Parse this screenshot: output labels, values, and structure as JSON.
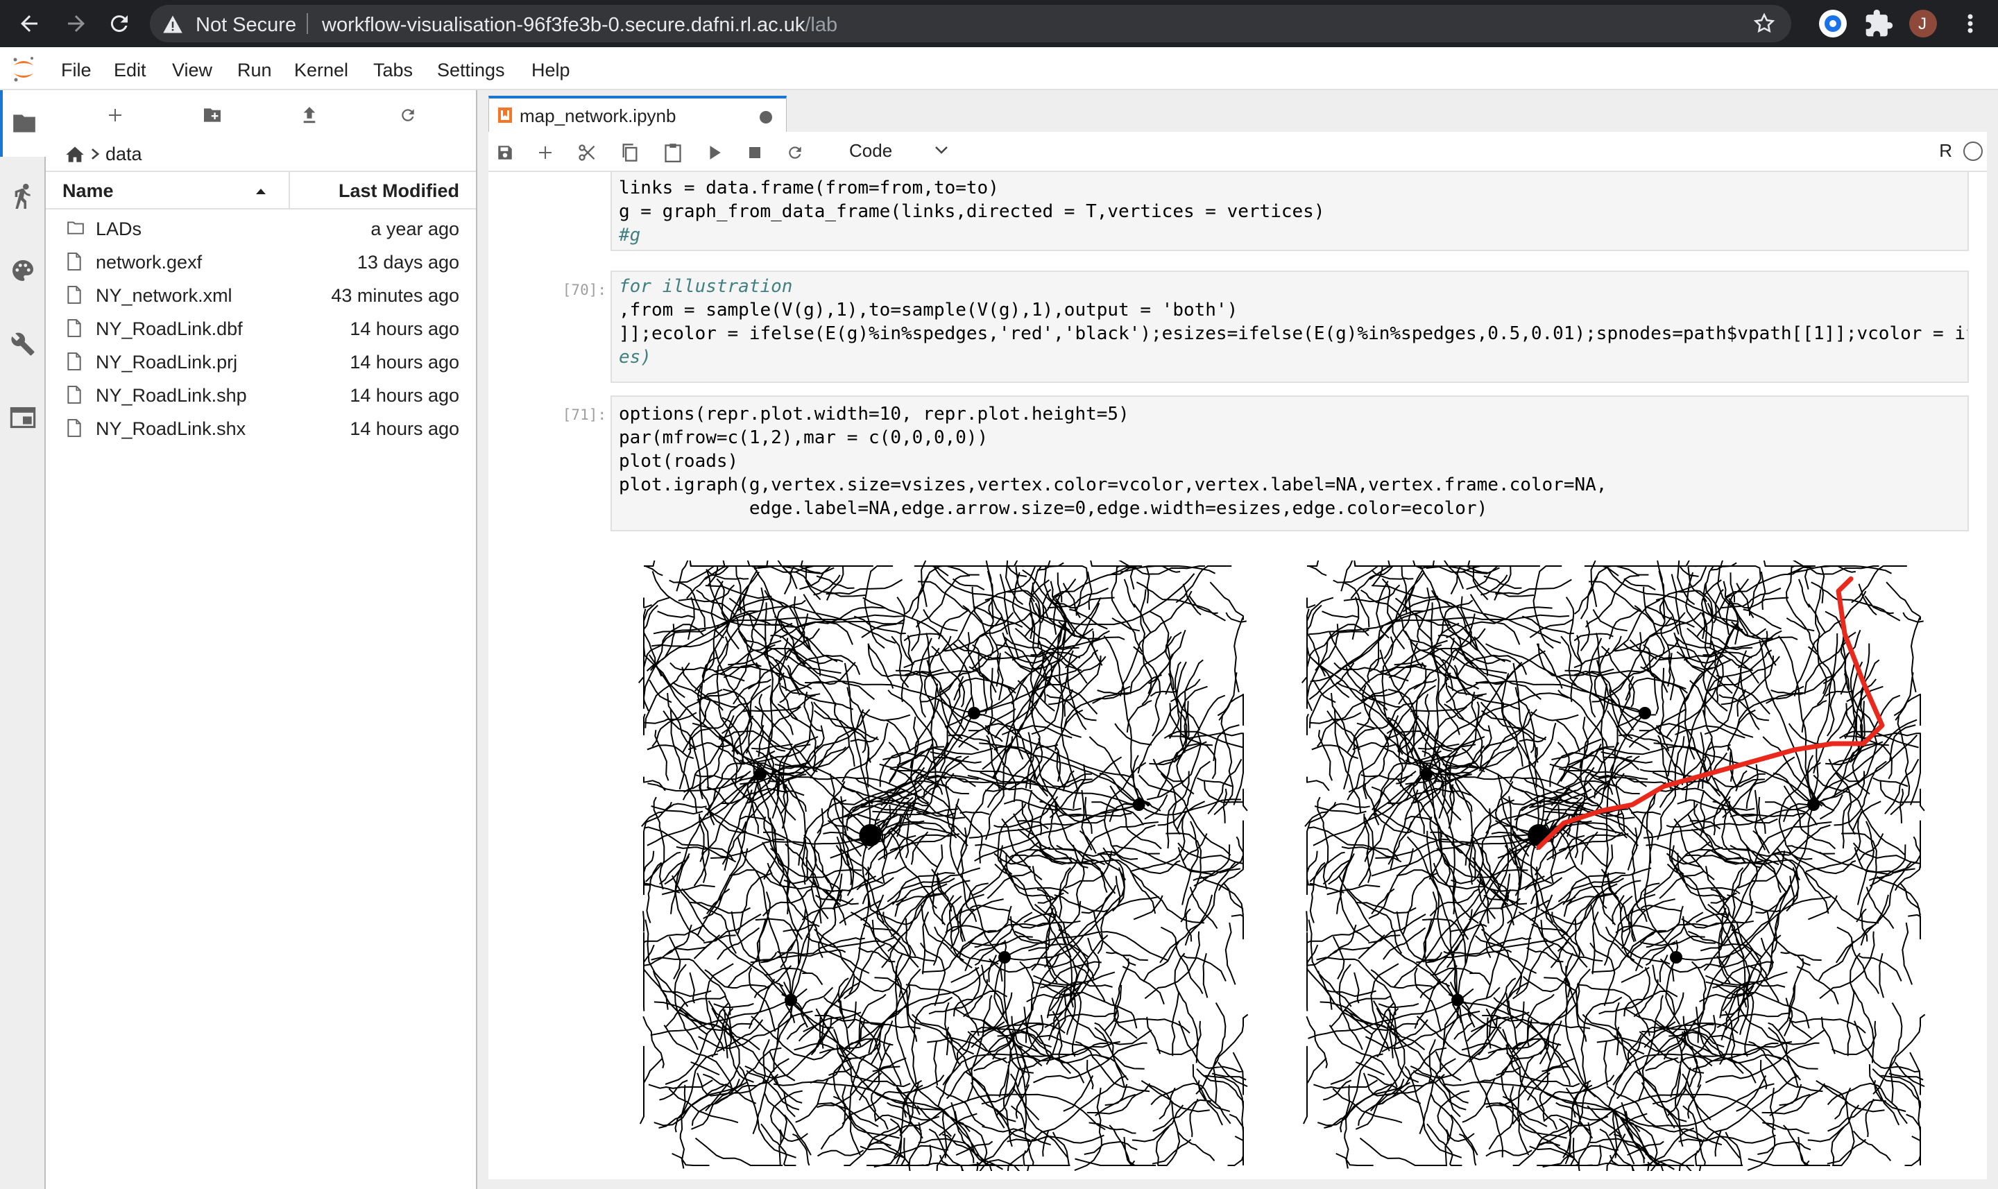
{
  "browser": {
    "security_label": "Not Secure",
    "url_host": "workflow-visualisation-96f3fe3b-0.secure.dafni.rl.ac.uk",
    "url_path": "/lab",
    "profile_initial": "J"
  },
  "menu": {
    "items": [
      "File",
      "Edit",
      "View",
      "Run",
      "Kernel",
      "Tabs",
      "Settings",
      "Help"
    ]
  },
  "file_browser": {
    "breadcrumb": "data",
    "columns": {
      "name": "Name",
      "modified": "Last Modified"
    },
    "files": [
      {
        "name": "LADs",
        "modified": "a year ago",
        "icon": "folder-icon"
      },
      {
        "name": "network.gexf",
        "modified": "13 days ago",
        "icon": "file-icon"
      },
      {
        "name": "NY_network.xml",
        "modified": "43 minutes ago",
        "icon": "file-icon"
      },
      {
        "name": "NY_RoadLink.dbf",
        "modified": "14 hours ago",
        "icon": "file-icon"
      },
      {
        "name": "NY_RoadLink.prj",
        "modified": "14 hours ago",
        "icon": "file-icon"
      },
      {
        "name": "NY_RoadLink.shp",
        "modified": "14 hours ago",
        "icon": "file-icon"
      },
      {
        "name": "NY_RoadLink.shx",
        "modified": "14 hours ago",
        "icon": "file-icon"
      }
    ]
  },
  "notebook": {
    "tab_title": "map_network.ipynb",
    "cell_type": "Code",
    "kernel_name": "R",
    "cells": [
      {
        "prompt": "",
        "lines": [
          "links = data.frame(from=from,to=to)",
          "g = graph_from_data_frame(links,directed = T,vertices = vertices)",
          "#g"
        ]
      },
      {
        "prompt": "[70]:",
        "lines": [
          "for illustration",
          ",from = sample(V(g),1),to=sample(V(g),1),output = 'both')",
          "]];ecolor = ifelse(E(g)%in%spedges,'red','black');esizes=ifelse(E(g)%in%spedges,0.5,0.01);spnodes=path$vpath[[1]];vcolor = if",
          "es)"
        ]
      },
      {
        "prompt": "[71]:",
        "lines": [
          "options(repr.plot.width=10, repr.plot.height=5)",
          "par(mfrow=c(1,2),mar = c(0,0,0,0))",
          "plot(roads)",
          "plot.igraph(g,vertex.size=vsizes,vertex.color=vcolor,vertex.label=NA,vertex.frame.color=NA,",
          "            edge.label=NA,edge.arrow.size=0,edge.width=esizes,edge.color=ecolor)"
        ]
      }
    ]
  },
  "colors": {
    "accent": "#1976d2",
    "road": "#000000",
    "path": "#e8291c"
  }
}
